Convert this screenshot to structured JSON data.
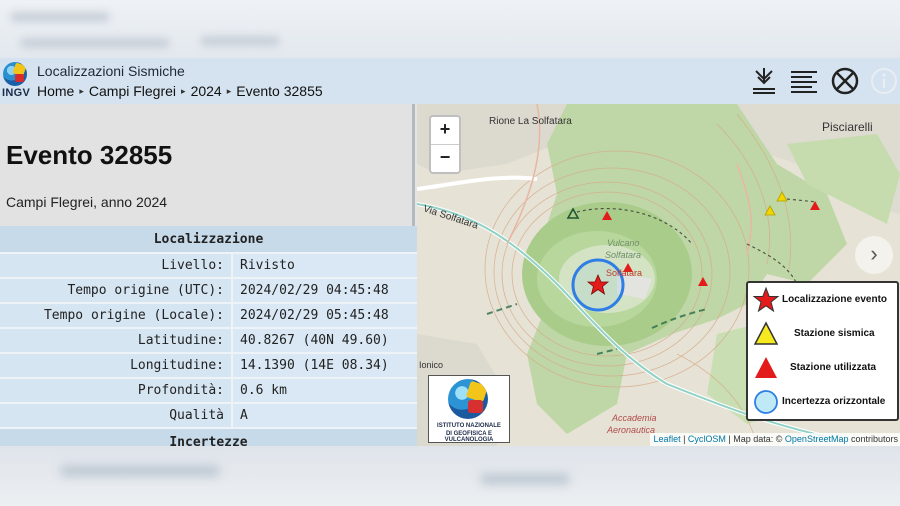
{
  "header": {
    "logo_text": "INGV",
    "title": "Localizzazioni Sismiche",
    "breadcrumb": [
      "Home",
      "Campi Flegrei",
      "2024",
      "Evento 32855"
    ],
    "icons": [
      "download-icon",
      "list-icon",
      "no-symbol-icon",
      "info-icon"
    ]
  },
  "event": {
    "title": "Evento 32855",
    "subtitle": "Campi Flegrei, anno 2024"
  },
  "table": {
    "section_header": "Localizzazione",
    "rows": [
      {
        "key": "Livello:",
        "value": "Rivisto"
      },
      {
        "key": "Tempo origine (UTC):",
        "value": "2024/02/29 04:45:48"
      },
      {
        "key": "Tempo origine (Locale):",
        "value": "2024/02/29 05:45:48"
      },
      {
        "key": "Latitudine:",
        "value": "40.8267 (40N 49.60)"
      },
      {
        "key": "Longitudine:",
        "value": "14.1390 (14E 08.34)"
      },
      {
        "key": "Profondità:",
        "value": "0.6 km"
      },
      {
        "key": "Qualità",
        "value": "A"
      }
    ],
    "next_section_header": "Incertezze"
  },
  "map": {
    "zoom_in": "+",
    "zoom_out": "−",
    "next": "›",
    "labels": {
      "rione": "Rione La Solfatara",
      "pisciarelli": "Pisciarelli",
      "via": "Via Solfatara",
      "vulcano": "Vulcano",
      "solfatara_italic": "Solfatara",
      "solfatara": "Solfatara",
      "ionico": "Ionico",
      "accademia": "Accademia",
      "aeronautica": "Aeronautica"
    },
    "legend": [
      {
        "label": "Localizzazione evento",
        "icon": "red-star-icon"
      },
      {
        "label": "Stazione sismica",
        "icon": "yellow-triangle-icon"
      },
      {
        "label": "Stazione utilizzata",
        "icon": "red-triangle-icon"
      },
      {
        "label": "Incertezza orizzontale",
        "icon": "light-blue-circle-icon"
      }
    ],
    "ingv_logo": {
      "line1": "ISTITUTO NAZIONALE",
      "line2": "DI GEOFISICA E VULCANOLOGIA"
    },
    "attribution": {
      "leaflet": "Leaflet",
      "sep1": " | ",
      "cyclosm": "CyclOSM",
      "mid": " | Map data: © ",
      "osm": "OpenStreetMap",
      "end": " contributors"
    }
  }
}
